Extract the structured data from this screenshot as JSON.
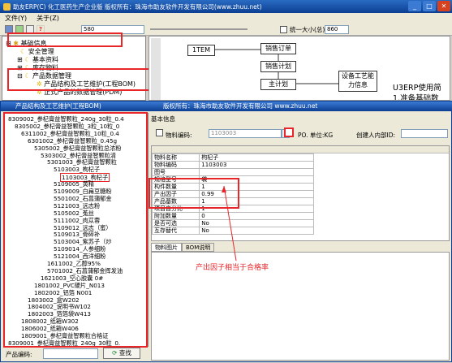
{
  "window": {
    "title": "助友ERP(C) 化工医药生产企业版    版权所有：珠海市助友软件开发有限公司(www.zhuu.net)"
  },
  "menu": [
    "文件(Y)",
    "关于(Z)"
  ],
  "toolbar": {
    "value": "580",
    "checkbox_label": "统一大小(总)",
    "size_value": "860"
  },
  "nav_tree": {
    "items": [
      {
        "label": "基础信息",
        "level": 0
      },
      {
        "label": "安全管理",
        "level": 1
      },
      {
        "label": "基本资料",
        "level": 1
      },
      {
        "label": "库存物料",
        "level": 1
      },
      {
        "label": "产品数据管理",
        "level": 1
      },
      {
        "label": "产品结构及工艺维护(工程BOM)",
        "level": 2
      },
      {
        "label": "正式产品的数据管理(PDM)",
        "level": 2
      }
    ]
  },
  "flow": {
    "boxes": [
      "1TEM",
      "销售订单",
      "销售计划",
      "主计划",
      "设备工艺能力信息"
    ],
    "side_text": [
      "U3ERP使用简",
      "1.准备基础数"
    ]
  },
  "window2": {
    "title": "产品结构及工艺维护(工程BOM)",
    "copyright": "版权所有：珠海市助友软件开发有限公司 www.zhuu.net"
  },
  "product_tree": [
    {
      "label": "8309002_参杞膏益智颗粒_240g_30粒_0.4",
      "level": 0
    },
    {
      "label": "8305002_参杞膏益智颗粒_3粒_10粒_0",
      "level": 1
    },
    {
      "label": "6311002_参杞膏益智颗粒_10粒_0.4",
      "level": 2
    },
    {
      "label": "6301002_参杞膏益智颗粒_0.45g",
      "level": 3
    },
    {
      "label": "5305002_参杞膏益智颗粒总浓粉",
      "level": 4
    },
    {
      "label": "5303002_参杞膏益智颗粒清",
      "level": 5
    },
    {
      "label": "5301003_参杞膏益智颗粒",
      "level": 6
    },
    {
      "label": "5103003_枸杞子",
      "level": 7
    },
    {
      "label": "1103003_枸杞子",
      "level": 8
    },
    {
      "label": "5109005_黄精",
      "level": 7
    },
    {
      "label": "5109009_白扁豆糖粉",
      "level": 7
    },
    {
      "label": "5501002_石菖蒲郁金",
      "level": 7
    },
    {
      "label": "5121003_远志粉",
      "level": 7
    },
    {
      "label": "5105002_菟丝",
      "level": 7
    },
    {
      "label": "5111002_肉苁蓉",
      "level": 7
    },
    {
      "label": "5109012_远志（蜜）",
      "level": 7
    },
    {
      "label": "5109013_骨碎补",
      "level": 7
    },
    {
      "label": "5103004_紫苏子（炒",
      "level": 7
    },
    {
      "label": "5109014_人参细粉",
      "level": 7
    },
    {
      "label": "5121004_西洋细粉",
      "level": 7
    },
    {
      "label": "1611002_乙醇95%",
      "level": 6
    },
    {
      "label": "5701002_石菖蒲郁金挥发油",
      "level": 6
    },
    {
      "label": "1621003_空心胶囊 0#",
      "level": 5
    },
    {
      "label": "1801002_PVC硬片_N013",
      "level": 4
    },
    {
      "label": "1802002_铝箔 N001",
      "level": 4
    },
    {
      "label": "1803002_盒W202",
      "level": 3
    },
    {
      "label": "1804002_说明书W102",
      "level": 3
    },
    {
      "label": "1802003_箔箔袋W413",
      "level": 3
    },
    {
      "label": "1808002_纸箱W302",
      "level": 2
    },
    {
      "label": "1806002_纸箱W406",
      "level": 2
    },
    {
      "label": "1809001_参杞膏益智颗粒合格证",
      "level": 2
    },
    {
      "label": "8309001_参杞膏益智颗粒_240g_30粒_0.",
      "level": 0
    }
  ],
  "search": {
    "label": "产品编码:",
    "button": "查找"
  },
  "tabs": [
    "基本信息"
  ],
  "form": {
    "checkbox_label": "物料编码:",
    "code_value": "1103003",
    "po_label": "PO. 单位:KG",
    "creator_label": "创建人内部ID:"
  },
  "properties": [
    {
      "name": "物料名称",
      "value": "枸杞子"
    },
    {
      "name": "物料编码",
      "value": "1103003"
    },
    {
      "name": "图号",
      "value": ""
    },
    {
      "name": "规格型号",
      "value": "袋"
    },
    {
      "name": "构件数量",
      "value": "1"
    },
    {
      "name": "产出因子",
      "value": "0.99"
    },
    {
      "name": "产品基数",
      "value": "1"
    },
    {
      "name": "项目自分比",
      "value": "1"
    },
    {
      "name": "附加数量",
      "value": "0"
    },
    {
      "name": "是否可选",
      "value": "No"
    },
    {
      "name": "互存替代",
      "value": "No"
    }
  ],
  "bottom_tabs": [
    "物料图片",
    "BOM说明"
  ],
  "annotation": "产出因子相当于合格率"
}
